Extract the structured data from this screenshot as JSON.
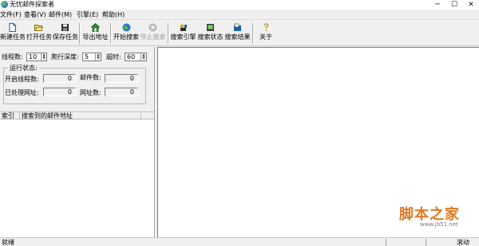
{
  "window": {
    "title": "无忧邮件探索者",
    "min": "─",
    "max": "☐",
    "close": "✕"
  },
  "menu": [
    "文件(F)",
    "查看(V)",
    "邮件(M)",
    "引擎(E)",
    "帮助(H)"
  ],
  "toolbar": {
    "new_task": "新建任务",
    "open_task": "打开任务",
    "save_task": "保存任务",
    "export_addr": "导出地址",
    "start_search": "开始搜索",
    "stop_search": "停止搜索",
    "search_engine": "搜索引擎",
    "search_status": "搜索状态",
    "search_result": "搜索结果",
    "about": "关于"
  },
  "params": {
    "threads_label": "线程数:",
    "threads_value": "10",
    "depth_label": "爬行深度:",
    "depth_value": "5",
    "timeout_label": "超时:",
    "timeout_value": "60"
  },
  "status_group": {
    "title": "运行状态:",
    "open_threads_label": "开启线程数:",
    "open_threads_value": "0",
    "mails_label": "邮件数:",
    "mails_value": "0",
    "processed_label": "已处理网址:",
    "processed_value": "0",
    "urls_label": "网址数:",
    "urls_value": "0"
  },
  "list": {
    "col_index": "索引",
    "col_email": "搜索到的邮件地址"
  },
  "statusbar": {
    "text": "就绪",
    "scroll": "滚动"
  },
  "watermark": {
    "main": "脚本之家",
    "sub": "www.jb51.net"
  }
}
